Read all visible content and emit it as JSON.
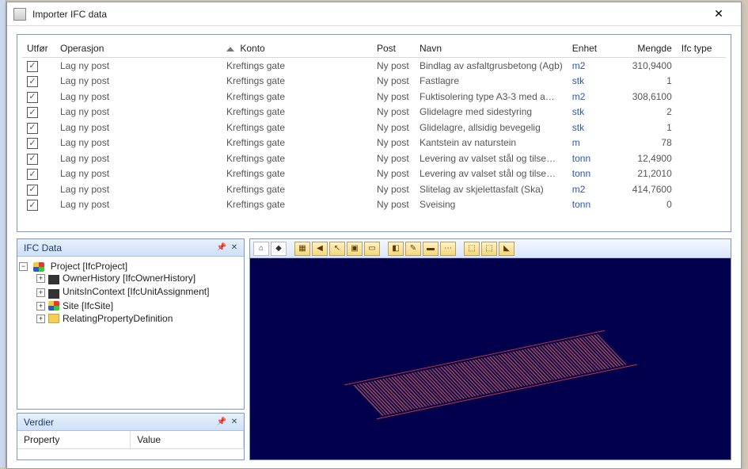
{
  "window": {
    "title": "Importer IFC data"
  },
  "table": {
    "headers": {
      "utfor": "Utfør",
      "operasjon": "Operasjon",
      "konto": "Konto",
      "post": "Post",
      "navn": "Navn",
      "enhet": "Enhet",
      "mengde": "Mengde",
      "ifctype": "Ifc type"
    },
    "rows": [
      {
        "op": "Lag ny post",
        "konto": "Kreftings gate",
        "post": "Ny post",
        "navn": "Bindlag av asfaltgrusbetong (Agb)",
        "enhet": "m2",
        "mengde": "310,9400"
      },
      {
        "op": "Lag ny post",
        "konto": "Kreftings gate",
        "post": "Ny post",
        "navn": "Fastlagre",
        "enhet": "stk",
        "mengde": "1"
      },
      {
        "op": "Lag ny post",
        "konto": "Kreftings gate",
        "post": "Ny post",
        "navn": "Fuktisolering type A3-3 med a…",
        "enhet": "m2",
        "mengde": "308,6100"
      },
      {
        "op": "Lag ny post",
        "konto": "Kreftings gate",
        "post": "Ny post",
        "navn": "Glidelagre med sidestyring",
        "enhet": "stk",
        "mengde": "2"
      },
      {
        "op": "Lag ny post",
        "konto": "Kreftings gate",
        "post": "Ny post",
        "navn": "Glidelagre, allsidig bevegelig",
        "enhet": "stk",
        "mengde": "1"
      },
      {
        "op": "Lag ny post",
        "konto": "Kreftings gate",
        "post": "Ny post",
        "navn": "Kantstein av naturstein",
        "enhet": "m",
        "mengde": "78"
      },
      {
        "op": "Lag ny post",
        "konto": "Kreftings gate",
        "post": "Ny post",
        "navn": "Levering av valset stål og tilse…",
        "enhet": "tonn",
        "mengde": "12,4900"
      },
      {
        "op": "Lag ny post",
        "konto": "Kreftings gate",
        "post": "Ny post",
        "navn": "Levering av valset stål og tilse…",
        "enhet": "tonn",
        "mengde": "21,2010"
      },
      {
        "op": "Lag ny post",
        "konto": "Kreftings gate",
        "post": "Ny post",
        "navn": "Slitelag av skjelettasfalt (Ska)",
        "enhet": "m2",
        "mengde": "414,7600"
      },
      {
        "op": "Lag ny post",
        "konto": "Kreftings gate",
        "post": "Ny post",
        "navn": "Sveising",
        "enhet": "tonn",
        "mengde": "0"
      }
    ]
  },
  "ifcpanel": {
    "title": "IFC Data",
    "root": "Project [IfcProject]",
    "children": [
      "OwnerHistory [IfcOwnerHistory]",
      "UnitsInContext [IfcUnitAssignment]",
      "Site [IfcSite]",
      "RelatingPropertyDefinition"
    ]
  },
  "verdier": {
    "title": "Verdier",
    "col_property": "Property",
    "col_value": "Value"
  },
  "toolbar": {
    "home": "home-icon",
    "view3d": "view3d-icon",
    "b1": "film-icon",
    "b2": "rewind-icon",
    "b3": "cursor-red-icon",
    "b4": "select-icon",
    "b5": "rect-icon",
    "b6": "layout-icon",
    "b7": "comment-icon",
    "b8": "window-icon",
    "b9": "span-icon",
    "b10": "bbox-icon",
    "b11": "bbox2-icon",
    "b12": "measure-icon"
  }
}
